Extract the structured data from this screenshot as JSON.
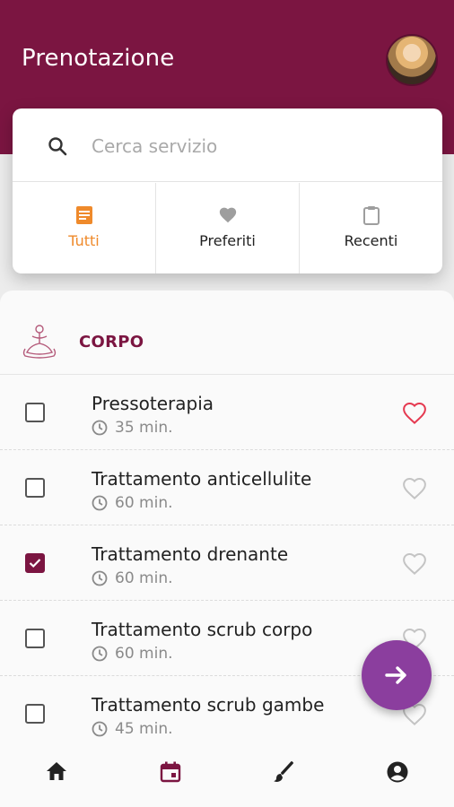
{
  "header": {
    "title": "Prenotazione",
    "color": "#7b1541"
  },
  "search": {
    "placeholder": "Cerca servizio",
    "value": ""
  },
  "tabs": [
    {
      "label": "Tutti",
      "icon": "document-icon",
      "active": true
    },
    {
      "label": "Preferiti",
      "icon": "heart-icon",
      "active": false
    },
    {
      "label": "Recenti",
      "icon": "clipboard-icon",
      "active": false
    }
  ],
  "section": {
    "title": "CORPO",
    "icon": "yoga-meditation-icon"
  },
  "services": [
    {
      "name": "Pressoterapia",
      "duration": "35 min.",
      "checked": false,
      "favorite": true
    },
    {
      "name": "Trattamento anticellulite",
      "duration": "60 min.",
      "checked": false,
      "favorite": false
    },
    {
      "name": "Trattamento drenante",
      "duration": "60 min.",
      "checked": true,
      "favorite": false
    },
    {
      "name": "Trattamento scrub corpo",
      "duration": "60 min.",
      "checked": false,
      "favorite": false
    },
    {
      "name": "Trattamento scrub gambe",
      "duration": "45 min.",
      "checked": false,
      "favorite": false
    }
  ],
  "fab": {
    "icon": "arrow-right-icon",
    "color": "#8b3e9e"
  },
  "bottom_nav": [
    {
      "icon": "home-icon",
      "active": false
    },
    {
      "icon": "calendar-icon",
      "active": true
    },
    {
      "icon": "brush-icon",
      "active": false
    },
    {
      "icon": "account-icon",
      "active": false
    }
  ],
  "colors": {
    "accent": "#7b1541",
    "active_tab": "#ef8a2b",
    "favorite": "#e53950"
  }
}
